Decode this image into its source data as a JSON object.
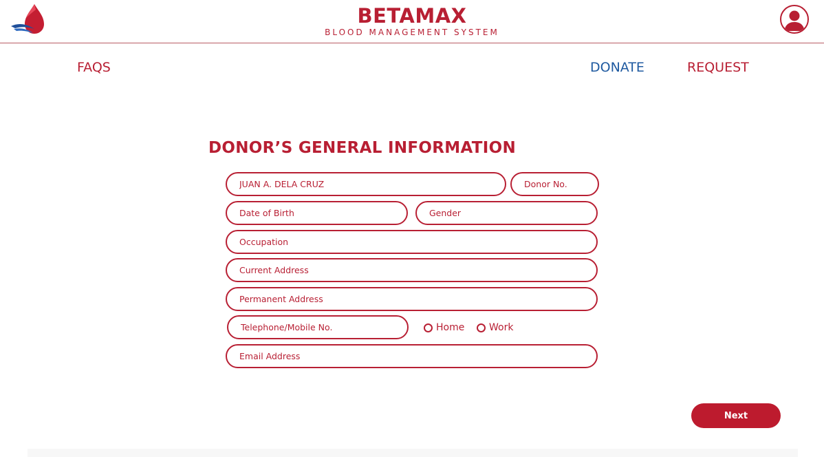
{
  "header": {
    "brand_title": "BETAMAX",
    "brand_subtitle": "BLOOD MANAGEMENT SYSTEM",
    "logo_icon": "blood-drop-logo",
    "avatar_icon": "user-avatar-icon"
  },
  "nav": {
    "faqs": "FAQS",
    "donate": "DONATE",
    "request": "REQUEST"
  },
  "form": {
    "title": "DONOR’S GENERAL INFORMATION",
    "full_name": {
      "value": "",
      "placeholder": "JUAN A. DELA CRUZ"
    },
    "donor_no": {
      "value": "",
      "placeholder": "Donor No."
    },
    "date_of_birth": {
      "value": "",
      "placeholder": "Date of Birth"
    },
    "gender": {
      "value": "",
      "placeholder": "Gender"
    },
    "occupation": {
      "value": "",
      "placeholder": "Occupation"
    },
    "current_address": {
      "value": "",
      "placeholder": "Current Address"
    },
    "permanent_address": {
      "value": "",
      "placeholder": "Permanent Address"
    },
    "telephone": {
      "value": "",
      "placeholder": "Telephone/Mobile No."
    },
    "phone_type_options": [
      "Home",
      "Work"
    ],
    "email": {
      "value": "",
      "placeholder": "Email Address"
    },
    "next_label": "Next"
  },
  "colors": {
    "brand_red": "#b81f33",
    "link_blue": "#1f5aa0",
    "button_red": "#bd1b2e"
  }
}
